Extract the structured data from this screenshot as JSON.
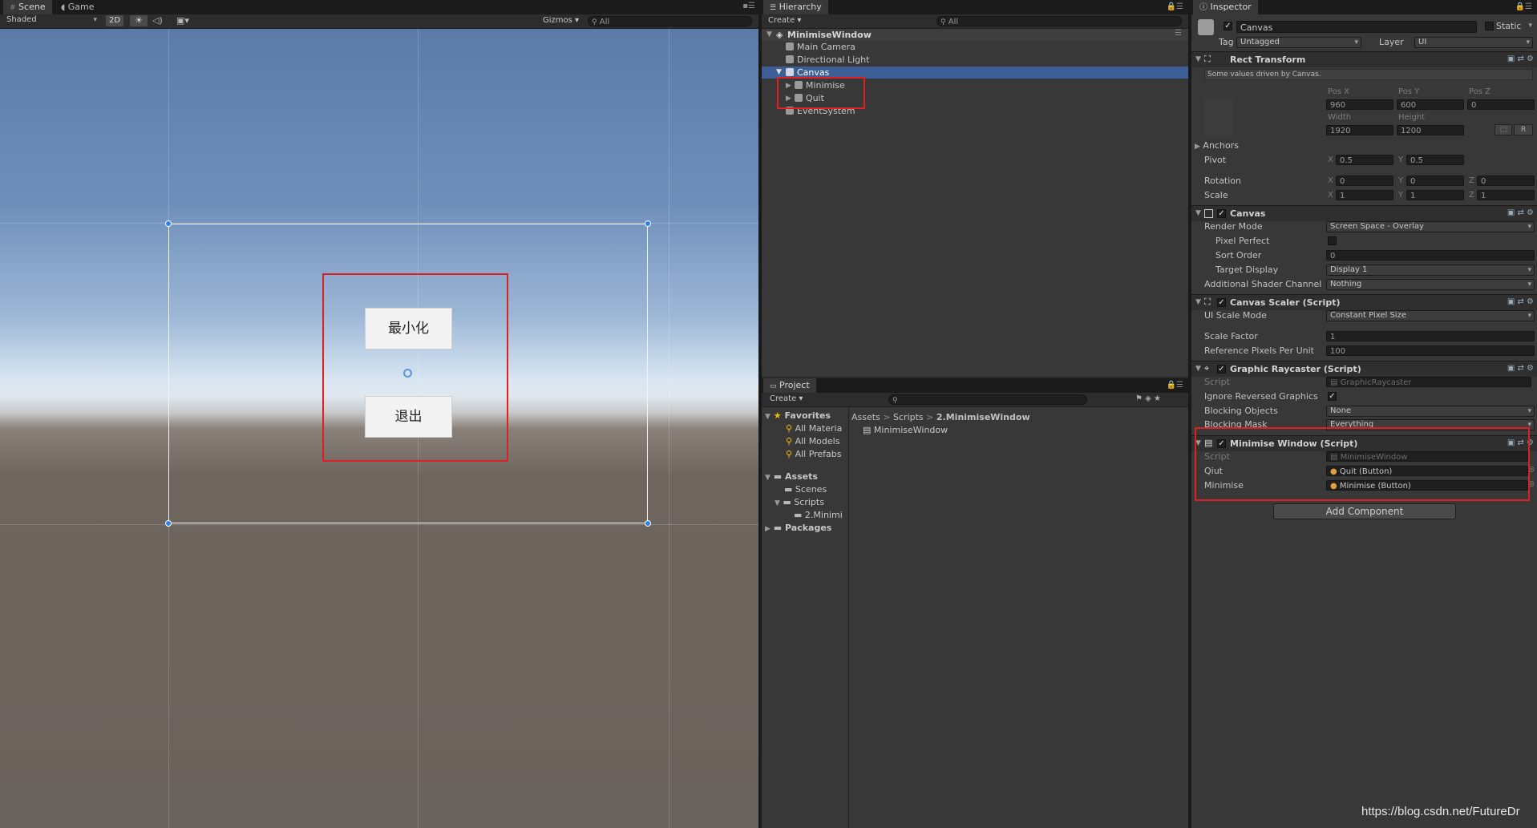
{
  "scene": {
    "tabs": [
      "Scene",
      "Game"
    ],
    "shading": "Shaded",
    "mode_2d": "2D",
    "gizmos": "Gizmos",
    "search_placeholder": "All",
    "button_minimise": "最小化",
    "button_quit": "退出"
  },
  "hierarchy": {
    "tab": "Hierarchy",
    "create": "Create",
    "search_placeholder": "All",
    "scene_name": "MinimiseWindow",
    "items": [
      "Main Camera",
      "Directional Light",
      "Canvas",
      "Minimise",
      "Quit",
      "EventSystem"
    ]
  },
  "project": {
    "tab": "Project",
    "create": "Create",
    "favorites": "Favorites",
    "fav_items": [
      "All Materia",
      "All Models",
      "All Prefabs"
    ],
    "assets": "Assets",
    "asset_items": [
      "Scenes",
      "Scripts",
      "2.Minimi"
    ],
    "packages": "Packages",
    "breadcrumb": [
      "Assets",
      "Scripts",
      "2.MinimiseWindow"
    ],
    "file": "MinimiseWindow"
  },
  "inspector": {
    "tab": "Inspector",
    "object_name": "Canvas",
    "static_label": "Static",
    "tag_label": "Tag",
    "tag_value": "Untagged",
    "layer_label": "Layer",
    "layer_value": "UI",
    "rect_transform": {
      "title": "Rect Transform",
      "note": "Some values driven by Canvas.",
      "pos_x_label": "Pos X",
      "pos_x": "960",
      "pos_y_label": "Pos Y",
      "pos_y": "600",
      "pos_z_label": "Pos Z",
      "pos_z": "0",
      "width_label": "Width",
      "width": "1920",
      "height_label": "Height",
      "height": "1200",
      "r_label": "R",
      "anchors": "Anchors",
      "pivot": "Pivot",
      "pivot_x": "0.5",
      "pivot_y": "0.5",
      "rotation": "Rotation",
      "rot_x": "0",
      "rot_y": "0",
      "rot_z": "0",
      "scale": "Scale",
      "scale_x": "1",
      "scale_y": "1",
      "scale_z": "1",
      "x": "X",
      "y": "Y",
      "z": "Z"
    },
    "canvas": {
      "title": "Canvas",
      "render_mode_label": "Render Mode",
      "render_mode": "Screen Space - Overlay",
      "pixel_perfect": "Pixel Perfect",
      "sort_order_label": "Sort Order",
      "sort_order": "0",
      "target_display_label": "Target Display",
      "target_display": "Display 1",
      "shader_channel_label": "Additional Shader Channel",
      "shader_channel": "Nothing"
    },
    "canvas_scaler": {
      "title": "Canvas Scaler (Script)",
      "ui_scale_mode_label": "UI Scale Mode",
      "ui_scale_mode": "Constant Pixel Size",
      "scale_factor_label": "Scale Factor",
      "scale_factor": "1",
      "ref_ppu_label": "Reference Pixels Per Unit",
      "ref_ppu": "100"
    },
    "graphic_raycaster": {
      "title": "Graphic Raycaster (Script)",
      "script_label": "Script",
      "script": "GraphicRaycaster",
      "ignore_reversed": "Ignore Reversed Graphics",
      "blocking_objects_label": "Blocking Objects",
      "blocking_objects": "None",
      "blocking_mask_label": "Blocking Mask",
      "blocking_mask": "Everything"
    },
    "minimise_window": {
      "title": "Minimise Window (Script)",
      "script_label": "Script",
      "script": "MinimiseWindow",
      "qiut_label": "Qiut",
      "qiut": "Quit (Button)",
      "minimise_label": "Minimise",
      "minimise": "Minimise (Button)"
    },
    "add_component": "Add Component"
  },
  "watermark": "https://blog.csdn.net/FutureDr"
}
